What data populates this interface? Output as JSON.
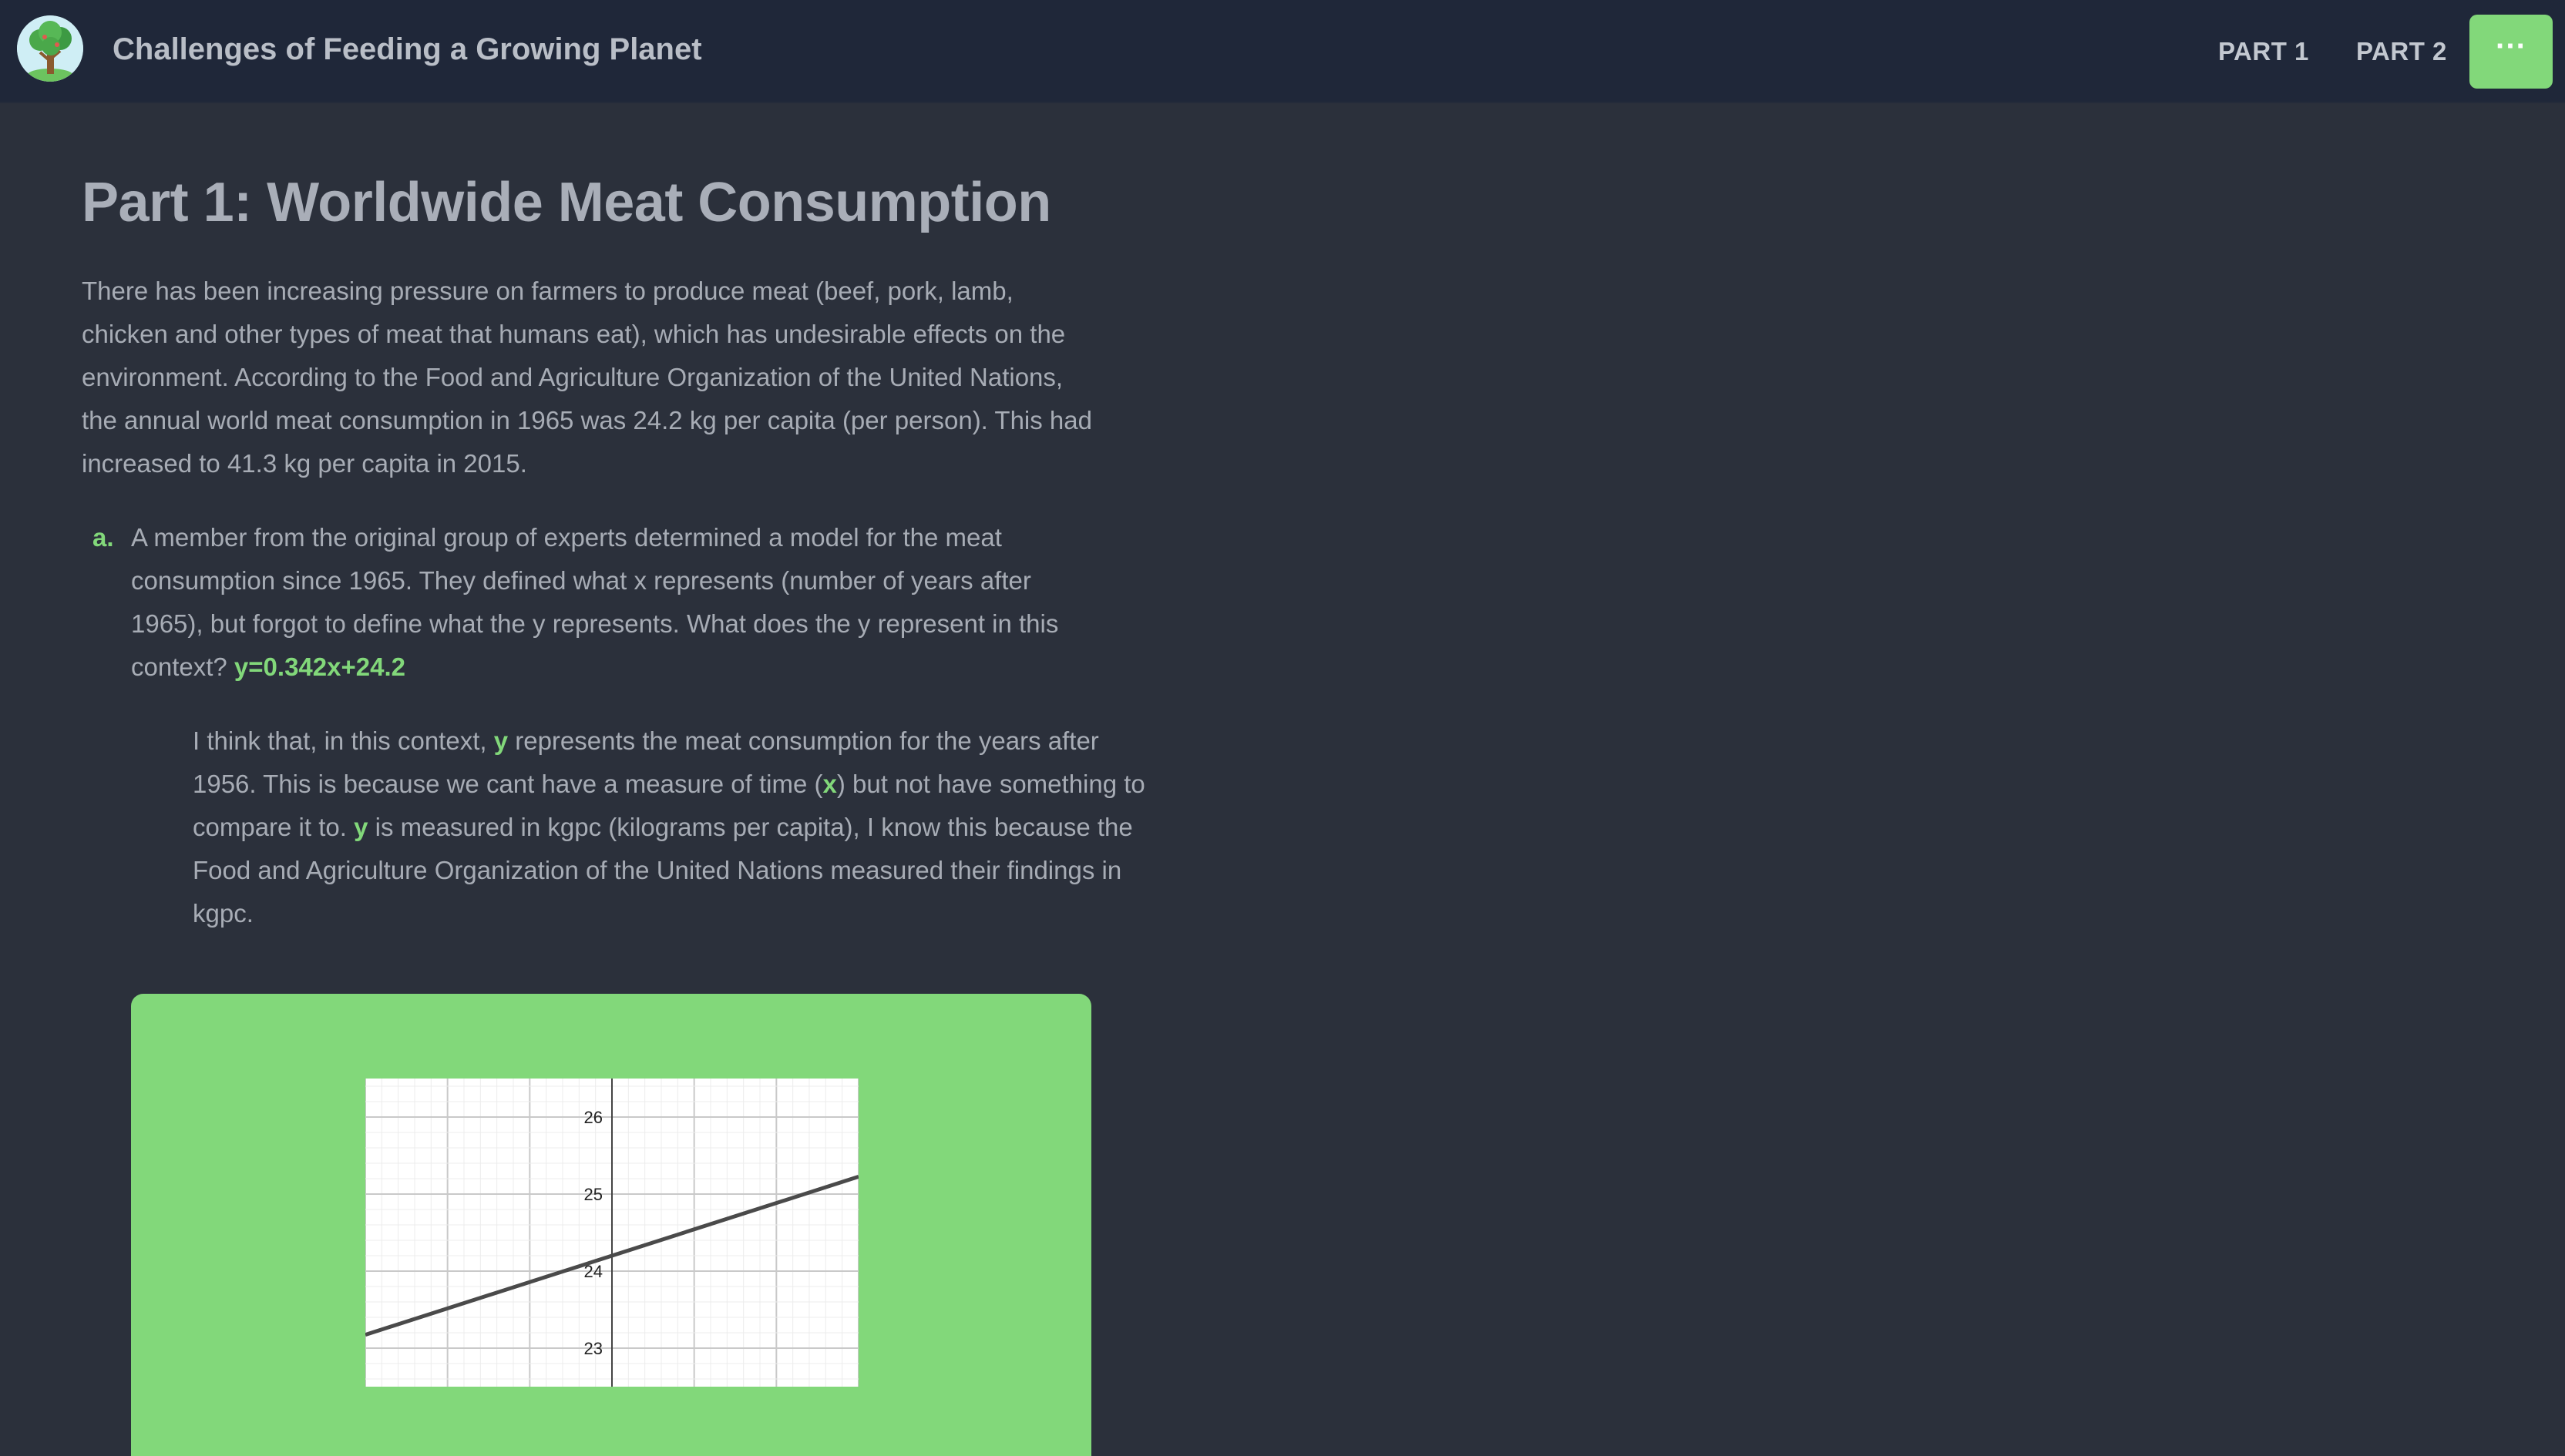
{
  "header": {
    "title": "Challenges of Feeding a Growing Planet",
    "nav": [
      "PART 1",
      "PART 2"
    ],
    "menu_label": "···",
    "accent": "#82d87a"
  },
  "page": {
    "heading": "Part 1: Worldwide Meat Consumption",
    "intro": "There has been increasing pressure on farmers to produce meat (beef, pork, lamb, chicken and other types of meat that humans eat), which has undesirable effects on the environment. According to the Food and Agriculture Organization of the United Nations, the annual world meat consumption in 1965 was 24.2 kg per capita (per person). This had increased to 41.3 kg per capita in 2015.",
    "question": {
      "marker": "a.",
      "text": "A member from the original group of experts determined a model for the meat consumption since 1965. They defined what x represents (number of years after 1965), but forgot to define what the y represents. What does the y represent in this context?",
      "equation": "y=0.342x+24.2"
    },
    "answer": {
      "p1": "I think that, in this context,",
      "y1": "y",
      "p2": "represents the meat consumption for the years after 1956. This is because we cant have a measure of time (",
      "x1": "x",
      "p3": ") but not have something to compare it to.",
      "y2": "y",
      "p4": "is measured in kgpc (kilograms per capita), I know this because the Food and Agriculture Organization of the United Nations measured their findings in kgpc."
    }
  },
  "chart_data": {
    "type": "line",
    "equation": "y=0.342x+24.2",
    "slope": 0.342,
    "intercept": 24.2,
    "xlim": [
      -3,
      3
    ],
    "ylim": [
      22.5,
      26.5
    ],
    "ytick_labels": [
      "26",
      "25",
      "24",
      "23"
    ],
    "grid": true
  }
}
